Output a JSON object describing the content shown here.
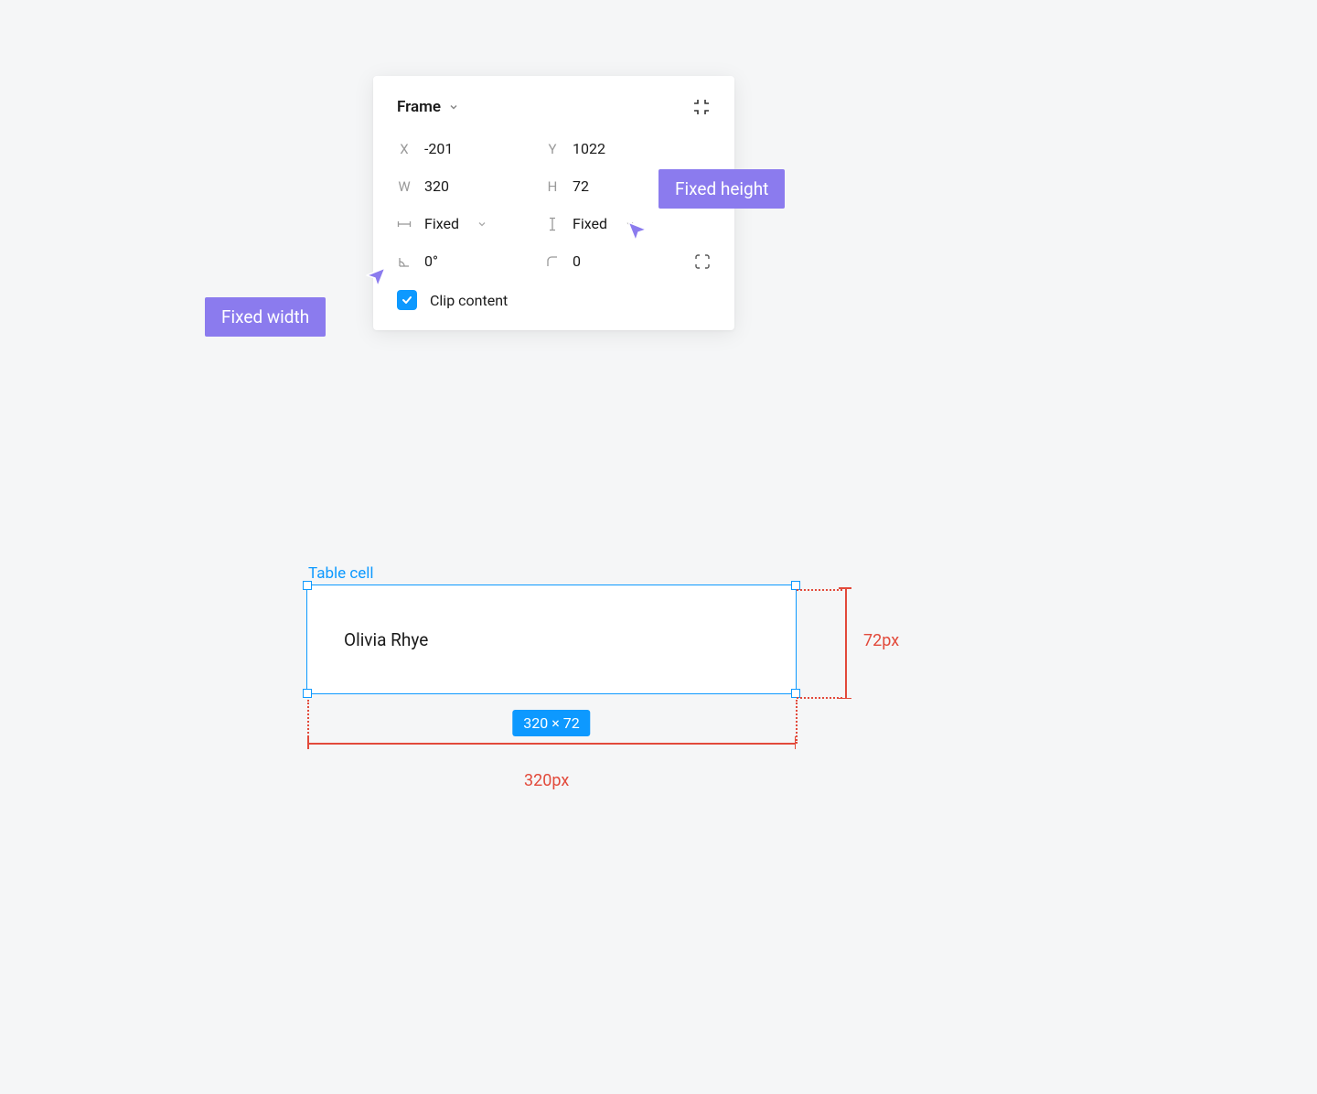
{
  "panel": {
    "title": "Frame",
    "x_label": "X",
    "x_value": "-201",
    "y_label": "Y",
    "y_value": "1022",
    "w_label": "W",
    "w_value": "320",
    "h_label": "H",
    "h_value": "72",
    "hmode_value": "Fixed",
    "vmode_value": "Fixed",
    "rotation_value": "0°",
    "radius_value": "0",
    "clip_label": "Clip content",
    "clip_checked": true
  },
  "callouts": {
    "width": "Fixed width",
    "height": "Fixed height"
  },
  "cell": {
    "layer_name": "Table cell",
    "text": "Olivia Rhye",
    "dimensions_badge": "320 × 72"
  },
  "measurements": {
    "height_label": "72px",
    "width_label": "320px"
  }
}
